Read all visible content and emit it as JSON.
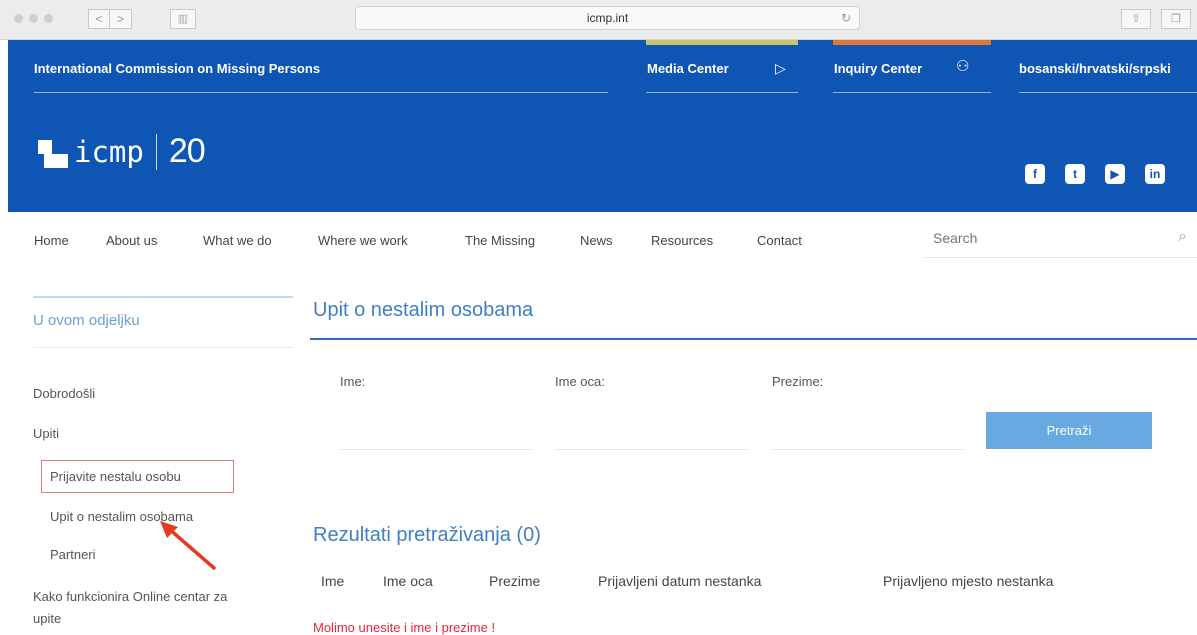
{
  "browser": {
    "url": "icmp.int",
    "back_label": "<",
    "forward_label": ">"
  },
  "header": {
    "org_name": "International Commission on Missing Persons",
    "media_center": "Media Center",
    "inquiry_center": "Inquiry Center",
    "language": "bosanski/hrvatski/srpski",
    "logo_text": "icmp",
    "logo_anniversary": "20",
    "social": [
      "facebook-icon",
      "twitter-icon",
      "youtube-icon",
      "linkedin-icon"
    ],
    "colors": {
      "header_blue": "#0f55b4",
      "media_tab": "#c7c36a",
      "inquiry_tab": "#e0763b"
    }
  },
  "nav": {
    "items": [
      "Home",
      "About us",
      "What we do",
      "Where we work",
      "The Missing",
      "News",
      "Resources",
      "Contact"
    ],
    "search_placeholder": "Search"
  },
  "sidebar": {
    "title": "U ovom odjeljku",
    "items": [
      "Dobrodošli",
      "Upiti",
      "Prijavite nestalu osobu",
      "Upit o nestalim osobama",
      "Partneri",
      "Kako funkcionira Online centar za",
      "upite"
    ]
  },
  "main": {
    "title": "Upit o nestalim osobama",
    "fields": {
      "first_name": "Ime:",
      "father_name": "Ime oca:",
      "last_name": "Prezime:"
    },
    "search_button": "Pretraži",
    "results_title": "Rezultati pretraživanja (0)",
    "columns": [
      "Ime",
      "Ime oca",
      "Prezime",
      "Prijavljeni datum nestanka",
      "Prijavljeno mjesto nestanka"
    ],
    "warning": "Molimo unesite i ime i prezime !"
  }
}
